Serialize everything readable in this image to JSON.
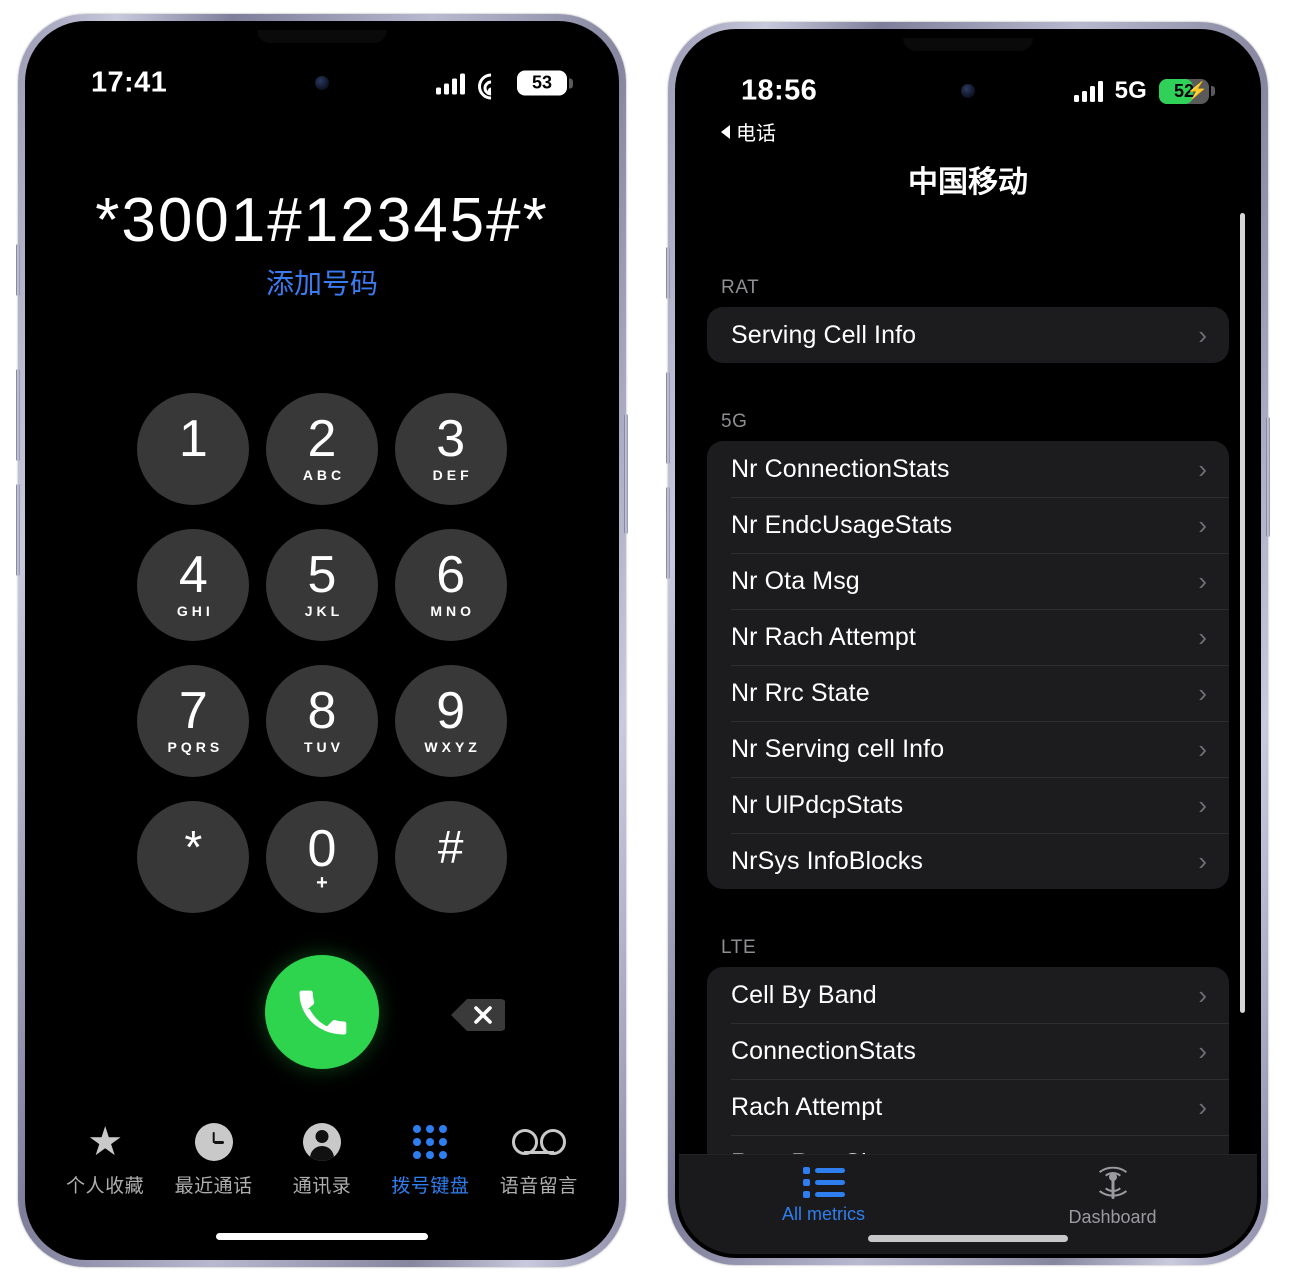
{
  "left_phone": {
    "status_bar": {
      "time": "17:41",
      "battery_percent": "53",
      "network_label": ""
    },
    "dialed_number": "*3001#12345#*",
    "add_number_label": "添加号码",
    "keypad": [
      {
        "digit": "1",
        "letters": ""
      },
      {
        "digit": "2",
        "letters": "ABC"
      },
      {
        "digit": "3",
        "letters": "DEF"
      },
      {
        "digit": "4",
        "letters": "GHI"
      },
      {
        "digit": "5",
        "letters": "JKL"
      },
      {
        "digit": "6",
        "letters": "MNO"
      },
      {
        "digit": "7",
        "letters": "PQRS"
      },
      {
        "digit": "8",
        "letters": "TUV"
      },
      {
        "digit": "9",
        "letters": "WXYZ"
      },
      {
        "digit": "*",
        "letters": ""
      },
      {
        "digit": "0",
        "letters": "+"
      },
      {
        "digit": "#",
        "letters": ""
      }
    ],
    "tabs": [
      {
        "label": "个人收藏",
        "icon": "star-icon",
        "active": false
      },
      {
        "label": "最近通话",
        "icon": "clock-icon",
        "active": false
      },
      {
        "label": "通讯录",
        "icon": "person-icon",
        "active": false
      },
      {
        "label": "拨号键盘",
        "icon": "keypad-icon",
        "active": true
      },
      {
        "label": "语音留言",
        "icon": "voicemail-icon",
        "active": false
      }
    ]
  },
  "right_phone": {
    "status_bar": {
      "time": "18:56",
      "network_label": "5G",
      "battery_percent": "52",
      "charging": true
    },
    "back_label": "电话",
    "title": "中国移动",
    "sections": [
      {
        "header": "RAT",
        "items": [
          "Serving Cell Info"
        ]
      },
      {
        "header": "5G",
        "items": [
          "Nr ConnectionStats",
          "Nr EndcUsageStats",
          "Nr Ota Msg",
          "Nr Rach Attempt",
          "Nr Rrc State",
          "Nr Serving cell Info",
          "Nr UlPdcpStats",
          "NrSys InfoBlocks"
        ]
      },
      {
        "header": "LTE",
        "items": [
          "Cell By Band",
          "ConnectionStats",
          "Rach Attempt",
          "Rsrp RsrqSinr"
        ]
      }
    ],
    "tabs": [
      {
        "label": "All metrics",
        "icon": "list-icon",
        "active": true
      },
      {
        "label": "Dashboard",
        "icon": "antenna-icon",
        "active": false
      }
    ]
  },
  "colors": {
    "accent_blue": "#2f7ef0",
    "call_green": "#2fd44e",
    "battery_green": "#30d158",
    "card_bg": "#1c1c1e"
  }
}
